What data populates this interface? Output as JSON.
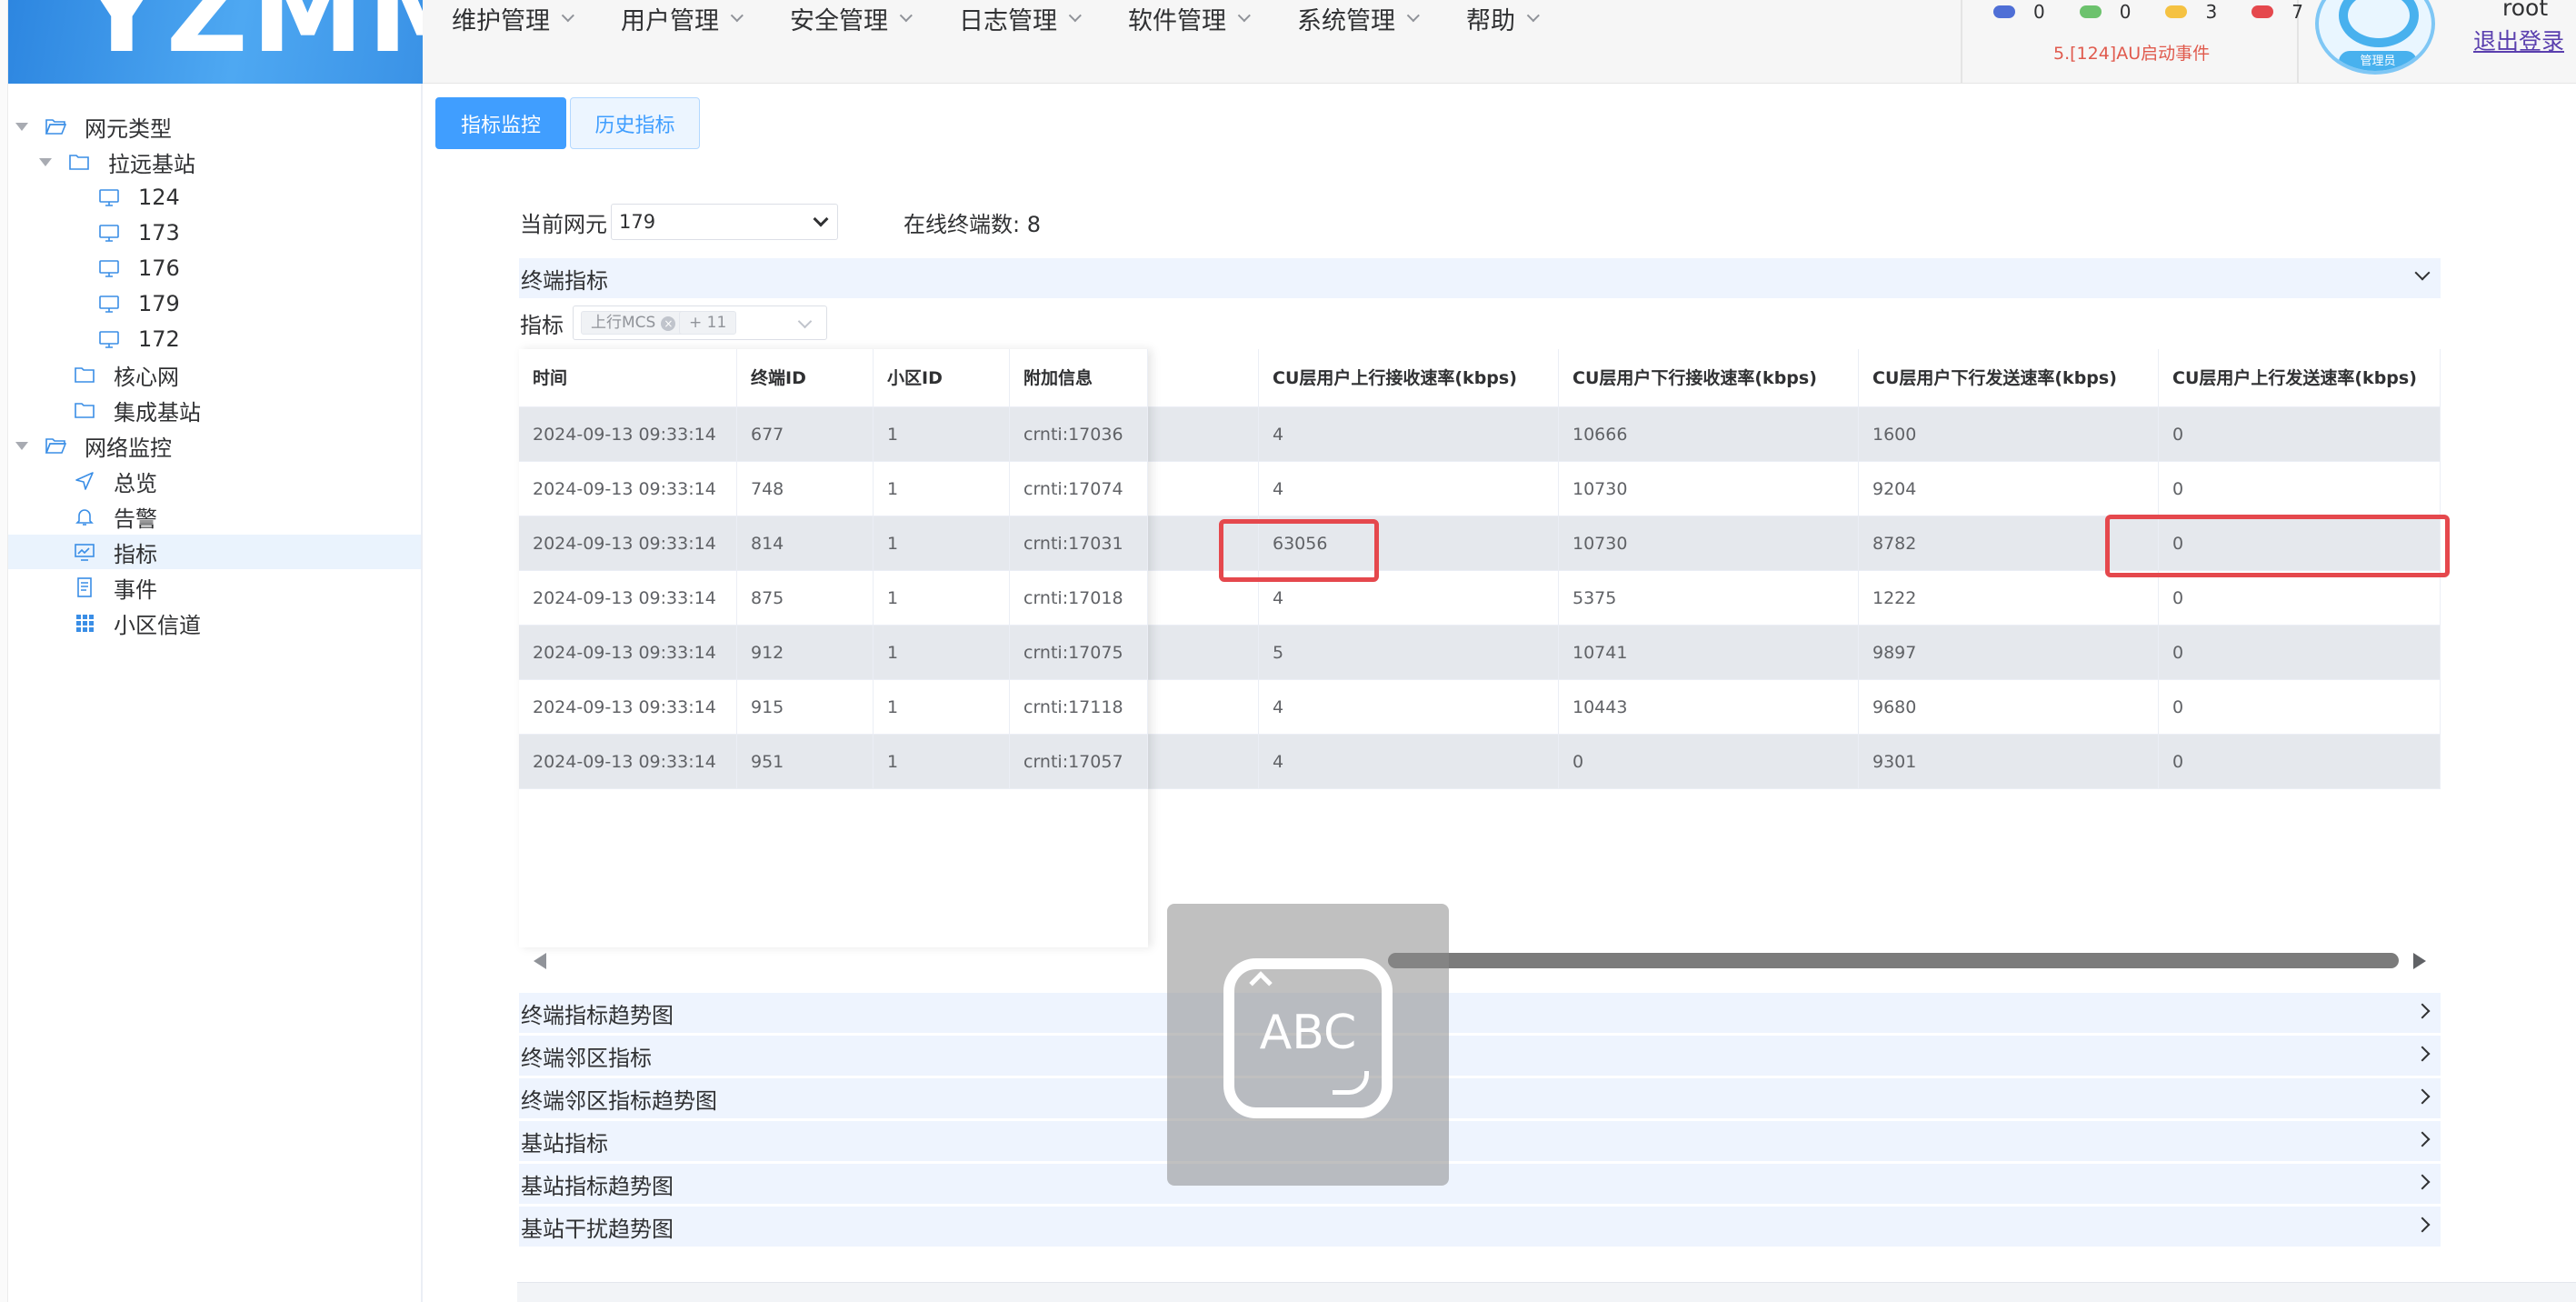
{
  "app": {
    "logo_text": "YZMM"
  },
  "header": {
    "menu": [
      {
        "label": "维护管理"
      },
      {
        "label": "用户管理"
      },
      {
        "label": "安全管理"
      },
      {
        "label": "日志管理"
      },
      {
        "label": "软件管理"
      },
      {
        "label": "系统管理"
      },
      {
        "label": "帮助"
      }
    ],
    "status_counts": [
      {
        "color": "#4f6fd6",
        "value": "0"
      },
      {
        "color": "#6cc26d",
        "value": "0"
      },
      {
        "color": "#f5c242",
        "value": "3"
      },
      {
        "color": "#e5484d",
        "value": "7"
      }
    ],
    "latest_event": "5.[124]AU启动事件",
    "avatar_badge": "管理员",
    "username": "root",
    "logout_label": "退出登录"
  },
  "sidebar": {
    "tree": [
      {
        "label": "网元类型",
        "icon": "folder-open-icon"
      },
      {
        "label": "拉远基站",
        "icon": "folder-icon"
      },
      {
        "label": "124",
        "icon": "monitor-icon"
      },
      {
        "label": "173",
        "icon": "monitor-icon"
      },
      {
        "label": "176",
        "icon": "monitor-icon"
      },
      {
        "label": "179",
        "icon": "monitor-icon"
      },
      {
        "label": "172",
        "icon": "monitor-icon"
      },
      {
        "label": "核心网",
        "icon": "folder-icon"
      },
      {
        "label": "集成基站",
        "icon": "folder-icon"
      },
      {
        "label": "网络监控",
        "icon": "folder-open-icon"
      },
      {
        "label": "总览",
        "icon": "navigation-icon"
      },
      {
        "label": "告警",
        "icon": "bell-icon"
      },
      {
        "label": "指标",
        "icon": "trend-chart-icon"
      },
      {
        "label": "事件",
        "icon": "document-icon"
      },
      {
        "label": "小区信道",
        "icon": "grid-icon"
      }
    ],
    "selected": "指标"
  },
  "tabs": [
    {
      "label": "指标监控"
    },
    {
      "label": "历史指标"
    }
  ],
  "filter": {
    "ne_label": "当前网元",
    "ne_value": "179",
    "online_label": "在线终端数: 8",
    "metric_label": "指标",
    "metric_tag": "上行MCS",
    "metric_more": "+ 11"
  },
  "section_terminal": "终端指标",
  "table": {
    "headers": [
      "时间",
      "终端ID",
      "小区ID",
      "附加信息",
      "CU层用户上行接收速率(kbps)",
      "CU层用户下行接收速率(kbps)",
      "CU层用户下行发送速率(kbps)",
      "CU层用户上行发送速率(kbps)"
    ],
    "rows": [
      [
        "2024-09-13 09:33:14",
        "677",
        "1",
        "crnti:17036",
        "4",
        "10666",
        "1600",
        "0"
      ],
      [
        "2024-09-13 09:33:14",
        "748",
        "1",
        "crnti:17074",
        "4",
        "10730",
        "9204",
        "0"
      ],
      [
        "2024-09-13 09:33:14",
        "814",
        "1",
        "crnti:17031",
        "63056",
        "10730",
        "8782",
        "0"
      ],
      [
        "2024-09-13 09:33:14",
        "875",
        "1",
        "crnti:17018",
        "4",
        "5375",
        "1222",
        "0"
      ],
      [
        "2024-09-13 09:33:14",
        "912",
        "1",
        "crnti:17075",
        "5",
        "10741",
        "9897",
        "0"
      ],
      [
        "2024-09-13 09:33:14",
        "915",
        "1",
        "crnti:17118",
        "4",
        "10443",
        "9680",
        "0"
      ],
      [
        "2024-09-13 09:33:14",
        "951",
        "1",
        "crnti:17057",
        "4",
        "0",
        "9301",
        "0"
      ]
    ]
  },
  "keyboard_overlay_text": "ABC",
  "sections": [
    {
      "label": "终端指标趋势图"
    },
    {
      "label": "终端邻区指标"
    },
    {
      "label": "终端邻区指标趋势图"
    },
    {
      "label": "基站指标"
    },
    {
      "label": "基站指标趋势图"
    },
    {
      "label": "基站干扰趋势图"
    }
  ]
}
